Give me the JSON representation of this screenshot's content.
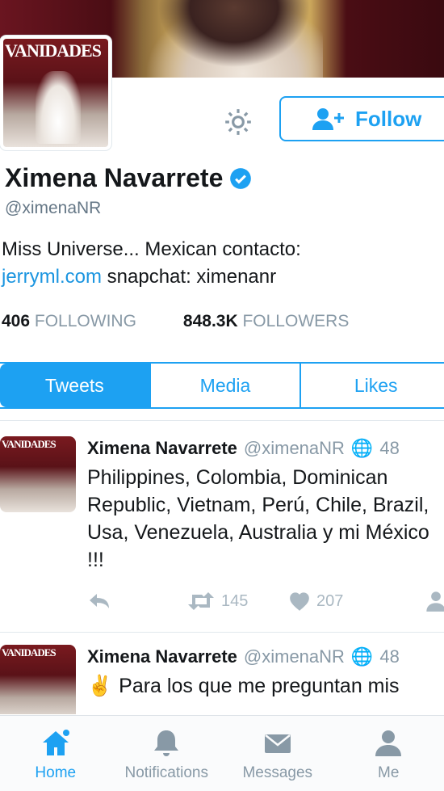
{
  "profile": {
    "name": "Ximena Navarrete",
    "handle": "@ximenaNR",
    "bio_text": "Miss Universe... Mexican contacto:",
    "bio_link": "jerryml.com",
    "bio_rest": " snapchat: ximenanr",
    "following_count": "406",
    "following_label": "FOLLOWING",
    "followers_count": "848.3K",
    "followers_label": "FOLLOWERS",
    "follow_label": "Follow",
    "cover_title": "VANIDADES"
  },
  "tabs": [
    {
      "label": "Tweets"
    },
    {
      "label": "Media"
    },
    {
      "label": "Likes"
    }
  ],
  "tweets": [
    {
      "name": "Ximena Navarrete",
      "handle": "@ximenaNR",
      "time": "48",
      "text": "Philippines, Colombia, Dominican Republic, Vietnam, Perú, Chile, Brazil, Usa, Venezuela, Australia y mi México !!!",
      "retweets": "145",
      "likes": "207"
    },
    {
      "name": "Ximena Navarrete",
      "handle": "@ximenaNR",
      "time": "48",
      "text": "Para los que me preguntan mis"
    }
  ],
  "tabbar": [
    {
      "label": "Home"
    },
    {
      "label": "Notifications"
    },
    {
      "label": "Messages"
    },
    {
      "label": "Me"
    }
  ],
  "colors": {
    "accent": "#1da1f2",
    "text": "#14171a",
    "muted": "#8899a6"
  }
}
